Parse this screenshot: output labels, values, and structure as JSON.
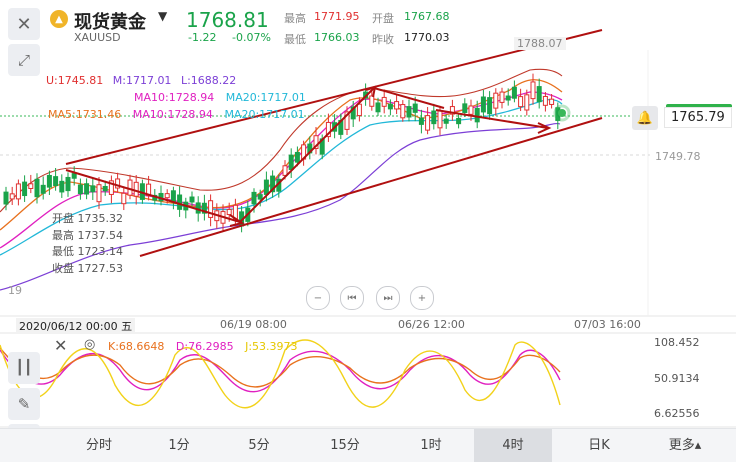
{
  "header": {
    "title": "现货黄金",
    "symbol": "XAUUSD",
    "price": "1768.81",
    "change": "-1.22",
    "change_pct": "-0.07%",
    "high_label": "最高",
    "high": "1771.95",
    "low_label": "最低",
    "low": "1766.03",
    "open_label": "开盘",
    "open": "1767.68",
    "prev_close_label": "昨收",
    "prev_close": "1770.03"
  },
  "indicators": {
    "bb_u": "U:1745.81",
    "bb_m": "M:1717.01",
    "bb_l": "L:1688.22",
    "ma10_a": "MA10:1728.94",
    "ma20_a": "MA20:1717.01",
    "ma5": "MA5:1731.46",
    "ma10_b": "MA10:1728.94",
    "ma20_b": "MA20:1717.01"
  },
  "ohlc_tooltip": {
    "open": "开盘  1735.32",
    "high": "最高  1737.54",
    "low": "最低  1723.14",
    "close": "收盘  1727.53"
  },
  "price_axis": {
    "top": "1788.07",
    "current": "1765.79",
    "mid": "1749.78",
    "left_edge": "19"
  },
  "time_axis": {
    "cursor": "2020/06/12 00:00 五",
    "t1": "06/19 08:00",
    "t2": "06/26 12:00",
    "t3": "07/03 16:00"
  },
  "kdj": {
    "k": "K:68.6648",
    "d": "D:76.2985",
    "j": "J:53.3973",
    "axis_top": "108.452",
    "axis_mid": "50.9134",
    "axis_bot": "6.62556"
  },
  "timeframes": [
    "分时",
    "1分",
    "5分",
    "15分",
    "1时",
    "4时",
    "日K",
    "更多▴"
  ],
  "active_timeframe": "4时",
  "colors": {
    "up": "#e03030",
    "down": "#1aa34a",
    "ma5": "#e8711e",
    "ma10": "#e020c0",
    "ma20": "#22b8d8",
    "bb_mid": "#7c3fd6",
    "trendline": "#b01010"
  }
}
